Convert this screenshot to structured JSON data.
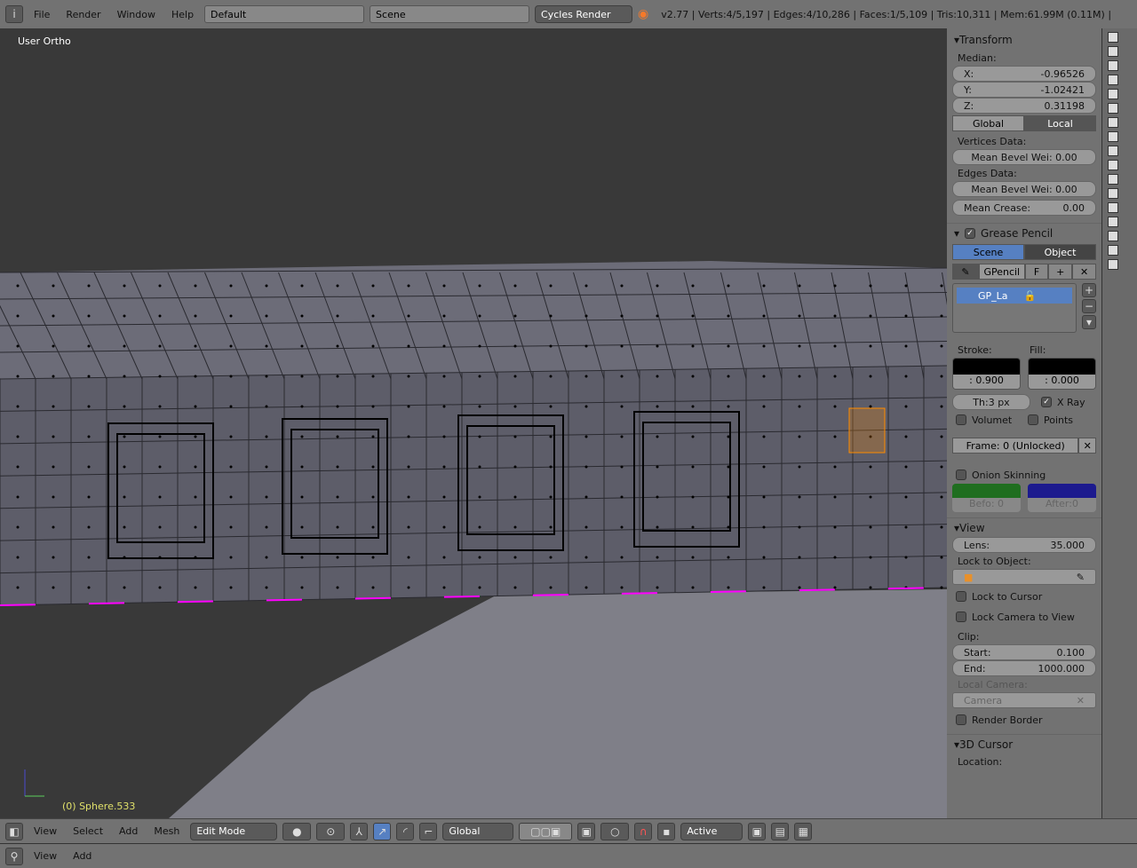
{
  "topbar": {
    "menus": [
      "File",
      "Render",
      "Window",
      "Help"
    ],
    "layout": "Default",
    "scene": "Scene",
    "engine": "Cycles Render",
    "stats": "v2.77 | Verts:4/5,197 | Edges:4/10,286 | Faces:1/5,109 | Tris:10,311 | Mem:61.99M (0.11M) |"
  },
  "viewport": {
    "view_label": "User Ortho",
    "object_label": "(0) Sphere.533"
  },
  "panel": {
    "transform": {
      "title": "Transform",
      "median": "Median:",
      "x_label": "X:",
      "x": "-0.96526",
      "y_label": "Y:",
      "y": "-1.02421",
      "z_label": "Z:",
      "z": "0.31198",
      "global": "Global",
      "local": "Local",
      "vertices_data": "Vertices Data:",
      "v_bevel": "Mean Bevel Wei: 0.00",
      "edges_data": "Edges Data:",
      "e_bevel": "Mean Bevel Wei: 0.00",
      "crease_label": "Mean Crease:",
      "crease": "0.00"
    },
    "grease": {
      "title": "Grease Pencil",
      "scene": "Scene",
      "object": "Object",
      "gpencil": "GPencil",
      "f": "F",
      "layer": "GP_La",
      "stroke": "Stroke:",
      "fill": "Fill:",
      "stroke_val": ": 0.900",
      "fill_val": ": 0.000",
      "thickness": "Th:3 px",
      "xray": "X Ray",
      "volumet": "Volumet",
      "points": "Points",
      "frame": "Frame: 0 (Unlocked)",
      "onion": "Onion Skinning",
      "before": "Befo: 0",
      "after": "After:0",
      "before_color": "#1f6e1f",
      "after_color": "#1c1a8e"
    },
    "view": {
      "title": "View",
      "lens_label": "Lens:",
      "lens": "35.000",
      "lock_obj": "Lock to Object:",
      "lock_cursor": "Lock to Cursor",
      "lock_cam": "Lock Camera to View",
      "clip": "Clip:",
      "start_label": "Start:",
      "start": "0.100",
      "end_label": "End:",
      "end": "1000.000",
      "local_cam": "Local Camera:",
      "camera": "Camera",
      "render_border": "Render Border"
    },
    "cursor": {
      "title": "3D Cursor",
      "location": "Location:"
    }
  },
  "header3d": {
    "menus": [
      "View",
      "Select",
      "Add",
      "Mesh"
    ],
    "mode": "Edit Mode",
    "orientation": "Global",
    "pivot": "Active"
  },
  "timeline": {
    "menus": [
      "View",
      "Add"
    ]
  },
  "colors": {
    "accent": "#5680c2",
    "selected": "#ff8c00",
    "seam": "#ff00ff"
  }
}
